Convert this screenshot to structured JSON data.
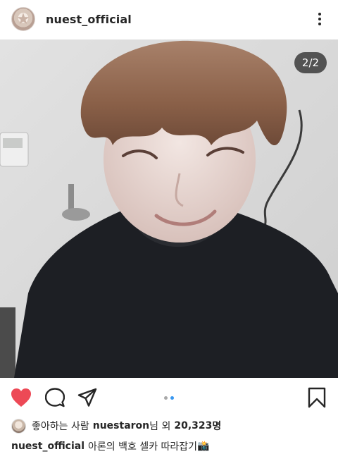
{
  "post": {
    "username": "nuest_official",
    "image_counter": "2/2",
    "carousel": {
      "total": 2,
      "active": 2
    },
    "likes": {
      "prefix": "좋아하는 사람",
      "liked_by": "nuestaron",
      "suffix_1": "님 외",
      "count": "20,323",
      "suffix_2": "명"
    },
    "caption": {
      "author": "nuest_official",
      "text": "아론의 백호 셀카 따라잡기",
      "emoji": "📸"
    }
  },
  "icons": {
    "more": "more-vertical-icon",
    "like": "heart-icon",
    "comment": "comment-icon",
    "share": "direct-share-icon",
    "save": "bookmark-icon"
  },
  "colors": {
    "heart": "#ed4956",
    "dot_active": "#3897f0",
    "dot_inactive": "#a8a8a8",
    "text": "#262626"
  }
}
